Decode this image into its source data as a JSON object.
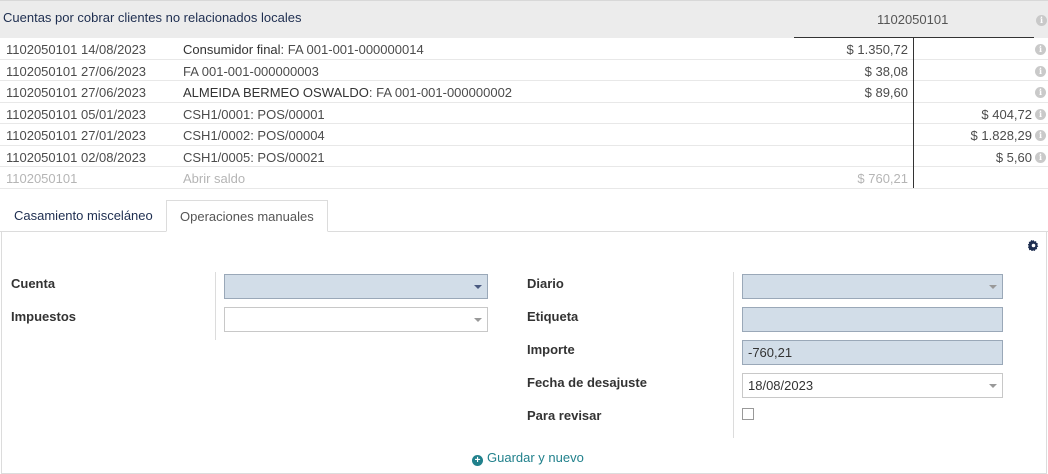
{
  "header": {
    "title": "Cuentas por cobrar clientes no relacionados locales",
    "account_code": "1102050101"
  },
  "rows": [
    {
      "account": "1102050101",
      "date": "14/08/2023",
      "partner": "Consumidor final",
      "ref": ": FA 001-001-000000014",
      "debit": "$ 1.350,72",
      "credit": ""
    },
    {
      "account": "1102050101",
      "date": "27/06/2023",
      "partner": "",
      "ref": "FA 001-001-000000003",
      "debit": "$ 38,08",
      "credit": ""
    },
    {
      "account": "1102050101",
      "date": "27/06/2023",
      "partner": "ALMEIDA BERMEO OSWALDO",
      "ref": ": FA 001-001-000000002",
      "debit": "$ 89,60",
      "credit": ""
    },
    {
      "account": "1102050101",
      "date": "05/01/2023",
      "partner": "",
      "ref": "CSH1/0001: POS/00001",
      "debit": "",
      "credit": "$ 404,72"
    },
    {
      "account": "1102050101",
      "date": "27/01/2023",
      "partner": "",
      "ref": "CSH1/0002: POS/00004",
      "debit": "",
      "credit": "$ 1.828,29"
    },
    {
      "account": "1102050101",
      "date": "02/08/2023",
      "partner": "",
      "ref": "CSH1/0005: POS/00021",
      "debit": "",
      "credit": "$ 5,60"
    }
  ],
  "open_balance": {
    "account": "1102050101",
    "label": "Abrir saldo",
    "amount": "$ 760,21"
  },
  "tabs": [
    "Casamiento misceláneo",
    "Operaciones manuales"
  ],
  "form": {
    "cuenta_label": "Cuenta",
    "impuestos_label": "Impuestos",
    "diario_label": "Diario",
    "etiqueta_label": "Etiqueta",
    "importe_label": "Importe",
    "importe_value": "-760,21",
    "fecha_label": "Fecha de desajuste",
    "fecha_value": "18/08/2023",
    "revisar_label": "Para revisar",
    "revisar_checked": false
  },
  "save_label": "Guardar y nuevo",
  "icons": {
    "info": "info-icon",
    "gear": "gear-icon",
    "plus": "plus-circle-icon",
    "caret": "chevron-down-icon"
  },
  "colors": {
    "accent": "#21818c",
    "title": "#1e2e50",
    "required_field": "#d2dde8"
  }
}
